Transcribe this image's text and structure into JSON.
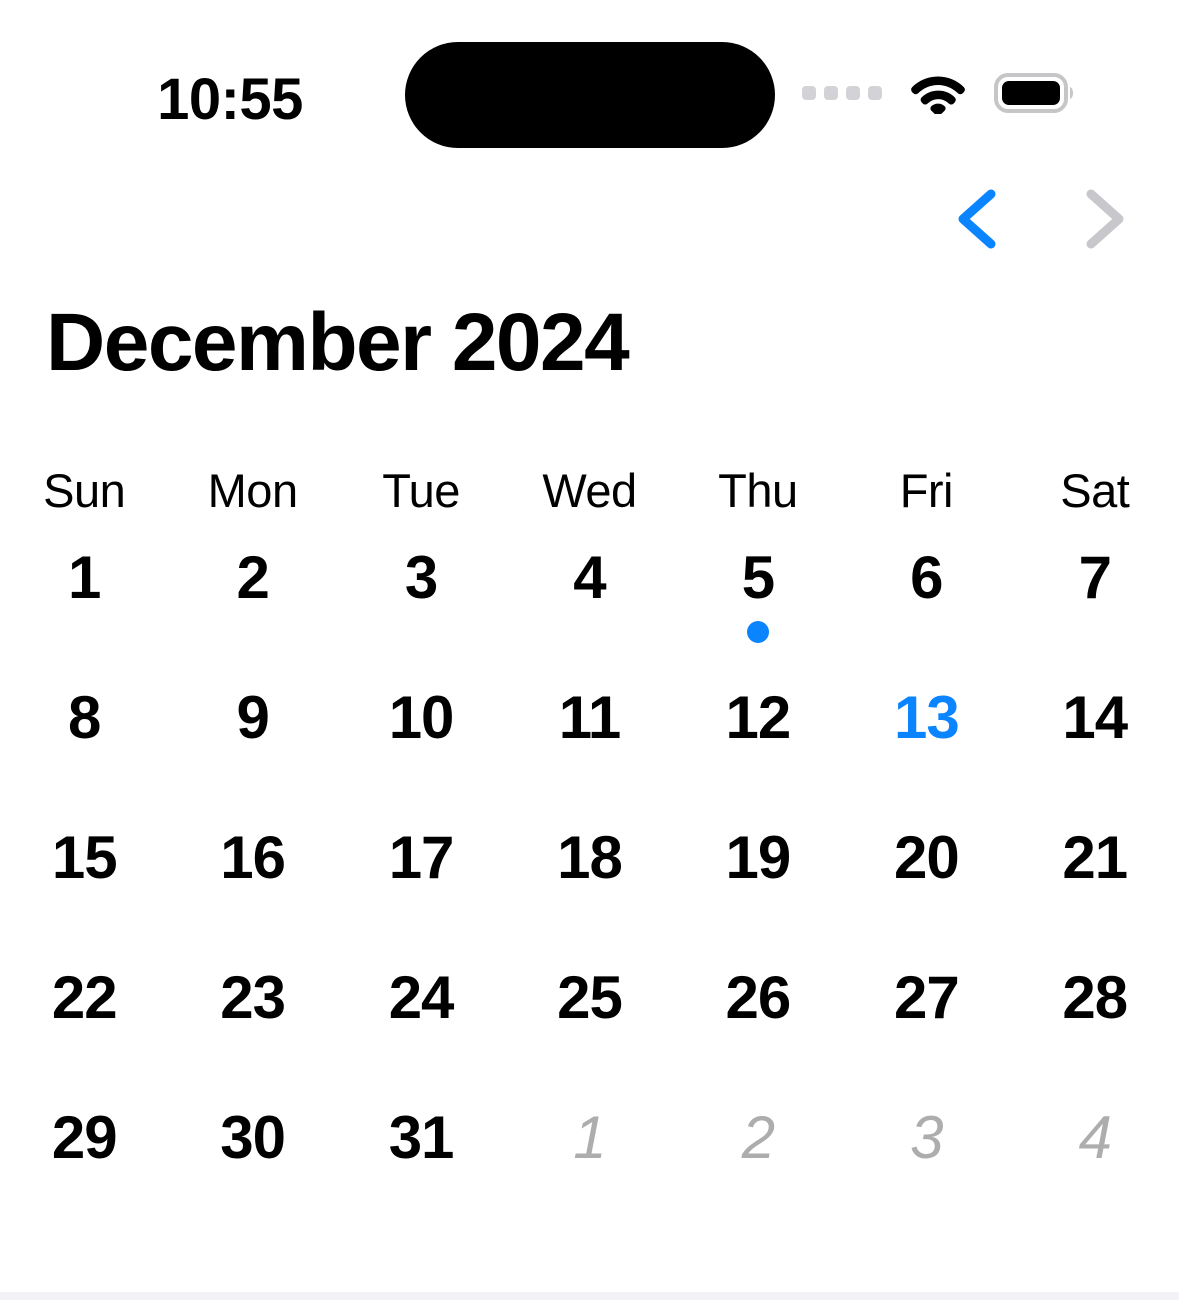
{
  "status_bar": {
    "time": "10:55",
    "cellular_icon": "cellular-dots-icon",
    "wifi_icon": "wifi-icon",
    "battery_icon": "battery-full-icon",
    "dynamic_island": "dynamic-island"
  },
  "nav": {
    "prev_label": "‹",
    "prev_icon": "chevron-left-icon",
    "prev_color": "#0a84ff",
    "prev_enabled": true,
    "next_label": "›",
    "next_icon": "chevron-right-icon",
    "next_color": "#c7c7cc",
    "next_enabled": false
  },
  "header": {
    "month_title": "December 2024"
  },
  "calendar": {
    "weekdays": [
      "Sun",
      "Mon",
      "Tue",
      "Wed",
      "Thu",
      "Fri",
      "Sat"
    ],
    "today": 13,
    "accent_color": "#0a84ff",
    "outside_color": "#adadad",
    "weeks": [
      [
        {
          "n": "1",
          "outside": false,
          "dot": false
        },
        {
          "n": "2",
          "outside": false,
          "dot": false
        },
        {
          "n": "3",
          "outside": false,
          "dot": false
        },
        {
          "n": "4",
          "outside": false,
          "dot": false
        },
        {
          "n": "5",
          "outside": false,
          "dot": true
        },
        {
          "n": "6",
          "outside": false,
          "dot": false
        },
        {
          "n": "7",
          "outside": false,
          "dot": false
        }
      ],
      [
        {
          "n": "8",
          "outside": false,
          "dot": false
        },
        {
          "n": "9",
          "outside": false,
          "dot": false
        },
        {
          "n": "10",
          "outside": false,
          "dot": false
        },
        {
          "n": "11",
          "outside": false,
          "dot": false
        },
        {
          "n": "12",
          "outside": false,
          "dot": false
        },
        {
          "n": "13",
          "outside": false,
          "dot": false,
          "today": true
        },
        {
          "n": "14",
          "outside": false,
          "dot": false
        }
      ],
      [
        {
          "n": "15",
          "outside": false,
          "dot": false
        },
        {
          "n": "16",
          "outside": false,
          "dot": false
        },
        {
          "n": "17",
          "outside": false,
          "dot": false
        },
        {
          "n": "18",
          "outside": false,
          "dot": false
        },
        {
          "n": "19",
          "outside": false,
          "dot": false
        },
        {
          "n": "20",
          "outside": false,
          "dot": false
        },
        {
          "n": "21",
          "outside": false,
          "dot": false
        }
      ],
      [
        {
          "n": "22",
          "outside": false,
          "dot": false
        },
        {
          "n": "23",
          "outside": false,
          "dot": false
        },
        {
          "n": "24",
          "outside": false,
          "dot": false
        },
        {
          "n": "25",
          "outside": false,
          "dot": false
        },
        {
          "n": "26",
          "outside": false,
          "dot": false
        },
        {
          "n": "27",
          "outside": false,
          "dot": false
        },
        {
          "n": "28",
          "outside": false,
          "dot": false
        }
      ],
      [
        {
          "n": "29",
          "outside": false,
          "dot": false
        },
        {
          "n": "30",
          "outside": false,
          "dot": false
        },
        {
          "n": "31",
          "outside": false,
          "dot": false
        },
        {
          "n": "1",
          "outside": true,
          "dot": false
        },
        {
          "n": "2",
          "outside": true,
          "dot": false
        },
        {
          "n": "3",
          "outside": true,
          "dot": false
        },
        {
          "n": "4",
          "outside": true,
          "dot": false
        }
      ]
    ]
  }
}
